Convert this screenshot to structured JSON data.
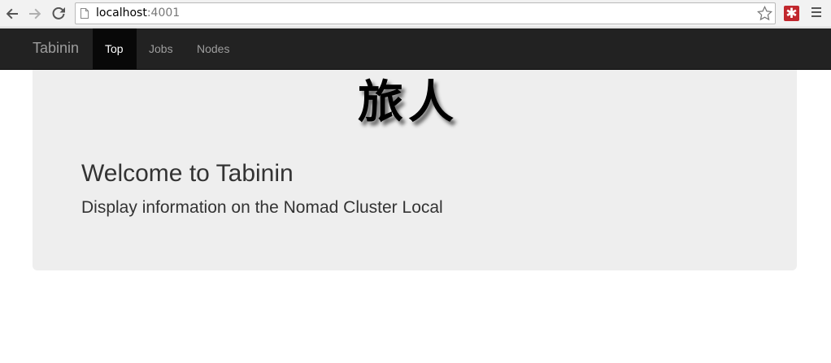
{
  "browser": {
    "url_host": "localhost",
    "url_port": ":4001",
    "extension_glyph": "✱",
    "icons": {
      "back": "arrow-left-icon",
      "forward": "arrow-right-icon",
      "reload": "reload-icon",
      "page": "page-icon",
      "bookmark": "star-icon",
      "extension": "extension-icon",
      "menu": "hamburger-menu-icon"
    }
  },
  "navbar": {
    "brand": "Tabinin",
    "items": [
      {
        "label": "Top",
        "active": true
      },
      {
        "label": "Jobs",
        "active": false
      },
      {
        "label": "Nodes",
        "active": false
      }
    ]
  },
  "jumbotron": {
    "logo_text": "旅人",
    "title": "Welcome to Tabinin",
    "subtitle": "Display information on the Nomad Cluster Local"
  },
  "colors": {
    "navbar_bg": "#222222",
    "navbar_active_bg": "#080808",
    "navbar_text": "#9d9d9d",
    "jumbotron_bg": "#eeeeee",
    "text": "#333333",
    "extension_red": "#c1272d"
  }
}
